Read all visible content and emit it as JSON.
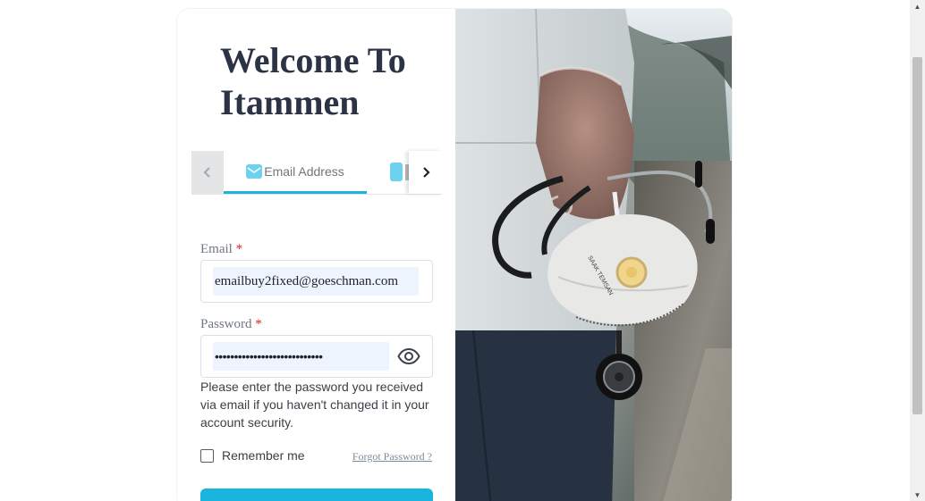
{
  "login": {
    "title": "Welcome To Itammen",
    "tabs": {
      "email_label": "Email Address",
      "email_icon": "envelope-icon",
      "phone_icon": "phone-icon",
      "prev_icon": "chevron-left-icon",
      "next_icon": "chevron-right-icon",
      "active_color": "#1eb2dc"
    },
    "email": {
      "label": "Email",
      "required_mark": "*",
      "value": "emailbuy2fixed@goeschman.com"
    },
    "password": {
      "label": "Password",
      "required_mark": "*",
      "value_masked": "••••••••••••••••••••••••••••",
      "toggle_icon": "eye-icon"
    },
    "help_text": "Please enter the password you received via email if you haven't changed it in your account security.",
    "remember_label": "Remember me",
    "remember_checked": false,
    "forgot_label": "Forgot Password ?",
    "submit_color": "#19b5de"
  },
  "photo": {
    "subject": "doctor holding stethoscope and face mask",
    "mask_text": "SAAK TEMSAN"
  },
  "scrollbar": {
    "up_icon": "scroll-up-arrow-icon",
    "down_icon": "scroll-down-arrow-icon"
  }
}
